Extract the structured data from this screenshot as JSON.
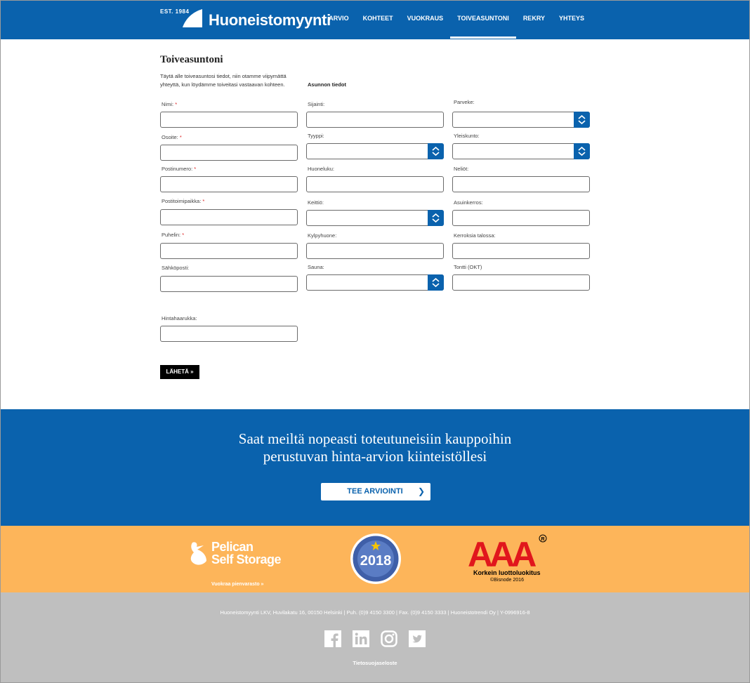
{
  "header": {
    "est": "EST. 1984",
    "brand": "Huoneistomyynti",
    "nav": [
      {
        "label": "ARVIO",
        "active": false
      },
      {
        "label": "KOHTEET",
        "active": false
      },
      {
        "label": "VUOKRAUS",
        "active": false
      },
      {
        "label": "TOIVEASUNTONI",
        "active": true
      },
      {
        "label": "REKRY",
        "active": false
      },
      {
        "label": "YHTEYS",
        "active": false
      }
    ]
  },
  "form": {
    "title": "Toiveasuntoni",
    "intro": "Täytä alle toiveasuntosi tiedot, niin otamme viipymättä yhteyttä, kun löydämme toiveitasi vastaavan kohteen.",
    "section_label": "Asunnon tiedot",
    "fields": {
      "nimi": {
        "label": "Nimi:",
        "required": "*",
        "value": ""
      },
      "osoite": {
        "label": "Osoite:",
        "required": "*",
        "value": ""
      },
      "postinumero": {
        "label": "Postinumero:",
        "required": "*",
        "value": ""
      },
      "postitoimipaikka": {
        "label": "Postitoimipaikka:",
        "required": "*",
        "value": ""
      },
      "puhelin": {
        "label": "Puhelin:",
        "required": "*",
        "value": ""
      },
      "sahkoposti": {
        "label": "Sähköposti:",
        "value": ""
      },
      "sijainti": {
        "label": "Sijainti:",
        "value": ""
      },
      "tyyppi": {
        "label": "Tyyppi:",
        "value": ""
      },
      "huoneluku": {
        "label": "Huoneluku:",
        "value": ""
      },
      "keittio": {
        "label": "Keittiö:",
        "value": ""
      },
      "kylpyhuone": {
        "label": "Kylpyhuone:",
        "value": ""
      },
      "sauna": {
        "label": "Sauna:",
        "value": ""
      },
      "parveke": {
        "label": "Parveke:",
        "value": ""
      },
      "yleiskunto": {
        "label": "Yleiskunto:",
        "value": ""
      },
      "neliot": {
        "label": "Neliöt:",
        "value": ""
      },
      "asuinkerros": {
        "label": "Asuinkerros:",
        "value": ""
      },
      "kerroksia": {
        "label": "Kerroksia talossa:",
        "value": ""
      },
      "tontti": {
        "label": "Tontti (OKT)",
        "value": ""
      },
      "hintahaarukka": {
        "label": "Hintahaarukka:",
        "value": ""
      }
    },
    "submit_label": "LÄHETÄ »"
  },
  "promo": {
    "line1": "Saat meiltä nopeasti toteutuneisiin kauppoihin",
    "line2": "perustuvan hinta-arvion kiinteistöllesi",
    "button_label": "TEE ARVIOINTI",
    "button_chevron": "❯"
  },
  "partners": {
    "pelican_line1": "Pelican",
    "pelican_line2": "Self Storage",
    "pelican_link": "Vuokraa pienvarasto »",
    "badge_year": "2018",
    "aaa_text": "AAA",
    "aaa_line1": "Korkein luottoluokitus",
    "aaa_line2": "©Bisnode 2016"
  },
  "footer": {
    "info": "Huoneistomyynti LKV, Huvilakatu 16, 00150 Helsinki | Puh. (0)9 4150 3300 | Fax. (0)9 4150 3333 | Huoneistotrendi Oy | Y-0996916-8",
    "socials": [
      "facebook-icon",
      "linkedin-icon",
      "instagram-icon",
      "twitter-icon"
    ],
    "privacy": "Tietosuojaseloste"
  },
  "colors": {
    "brand_blue": "#0a62ad",
    "orange": "#fdb55a",
    "footer_gray": "#bfbfbf",
    "aaa_red": "#e1161c"
  }
}
